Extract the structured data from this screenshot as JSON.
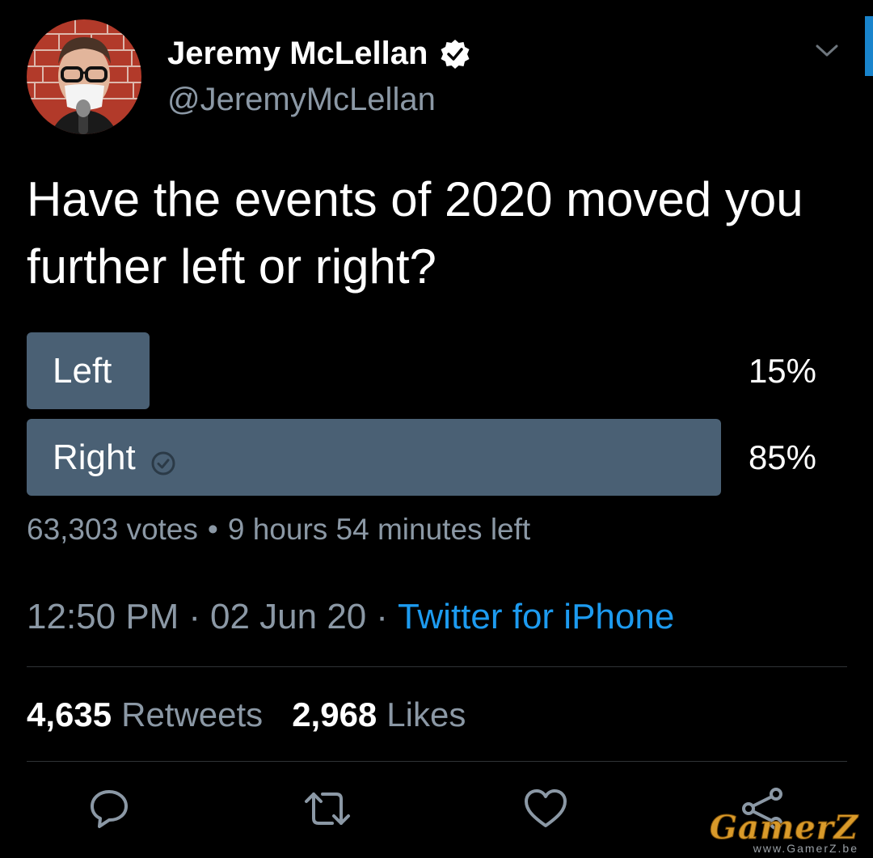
{
  "author": {
    "display_name": "Jeremy McLellan",
    "handle": "@JeremyMcLellan",
    "verified": true
  },
  "tweet": {
    "text": "Have the events of 2020 moved you further left or right?"
  },
  "poll": {
    "options": [
      {
        "label": "Left",
        "percent_text": "15%",
        "fraction": 0.15,
        "winner": false
      },
      {
        "label": "Right",
        "percent_text": "85%",
        "fraction": 0.85,
        "winner": true
      }
    ],
    "votes_text": "63,303 votes",
    "separator": "•",
    "time_left": "9 hours 54 minutes left"
  },
  "meta": {
    "time": "12:50 PM",
    "dot": "·",
    "date": "02 Jun 20",
    "source": "Twitter for iPhone"
  },
  "stats": {
    "retweets_count": "4,635",
    "retweets_label": "Retweets",
    "likes_count": "2,968",
    "likes_label": "Likes"
  },
  "icons": {
    "reply": "reply-icon",
    "retweet": "retweet-icon",
    "like": "like-icon",
    "share": "share-icon",
    "verified": "verified-badge-icon",
    "chevron": "chevron-down-icon"
  },
  "colors": {
    "background": "#000000",
    "accent": "#1d9bf0",
    "poll_bar": "#4a6074",
    "secondary_text": "#8b98a5"
  },
  "watermark": {
    "brand": "GamerZ",
    "url": "www.GamerZ.be"
  }
}
